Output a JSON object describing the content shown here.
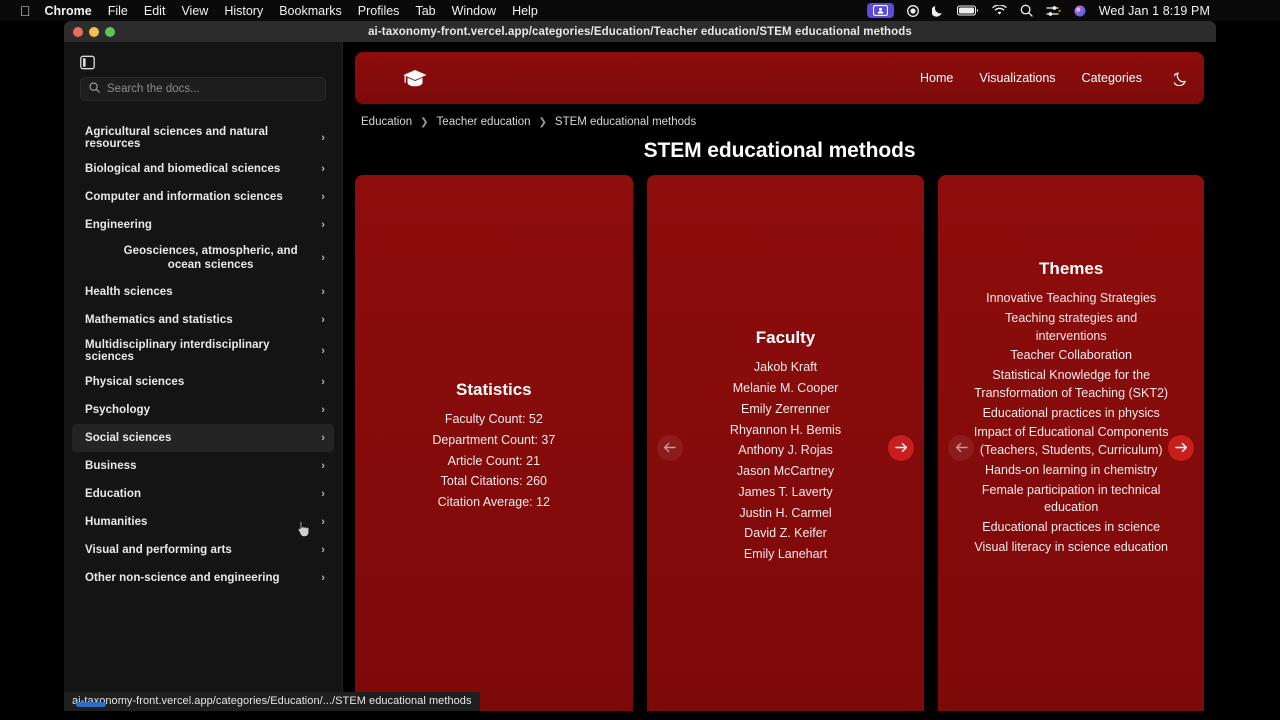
{
  "menubar": {
    "apple_icon": "apple-icon",
    "items": [
      {
        "label": "Chrome",
        "bold": true
      },
      {
        "label": "File",
        "bold": false
      },
      {
        "label": "Edit",
        "bold": false
      },
      {
        "label": "View",
        "bold": false
      },
      {
        "label": "History",
        "bold": false
      },
      {
        "label": "Bookmarks",
        "bold": false
      },
      {
        "label": "Profiles",
        "bold": false
      },
      {
        "label": "Tab",
        "bold": false
      },
      {
        "label": "Window",
        "bold": false
      },
      {
        "label": "Help",
        "bold": false
      }
    ],
    "status_icons": [
      "screen-share-icon",
      "record-icon",
      "moon-icon",
      "battery-icon",
      "wifi-icon",
      "search-icon",
      "control-center-icon",
      "siri-icon"
    ],
    "datetime": "Wed Jan 1  8:19 PM",
    "highlight_color": "#5b4bd6"
  },
  "window": {
    "title_url": "ai-taxonomy-front.vercel.app/categories/Education/Teacher education/STEM educational methods",
    "traffic_lights": [
      "close-button",
      "minimize-button",
      "maximize-button"
    ]
  },
  "sidebar": {
    "toggle_icon": "sidebar-toggle-icon",
    "search": {
      "icon": "search-icon",
      "placeholder": "Search the docs...",
      "value": ""
    },
    "items": [
      {
        "label": "Agricultural sciences and natural resources",
        "sub": false,
        "active": false
      },
      {
        "label": "Biological and biomedical sciences",
        "sub": false,
        "active": false
      },
      {
        "label": "Computer and information sciences",
        "sub": false,
        "active": false
      },
      {
        "label": "Engineering",
        "sub": false,
        "active": false
      },
      {
        "label": "Geosciences, atmospheric, and ocean sciences",
        "sub": true,
        "active": false
      },
      {
        "label": "Health sciences",
        "sub": false,
        "active": false
      },
      {
        "label": "Mathematics and statistics",
        "sub": false,
        "active": false
      },
      {
        "label": "Multidisciplinary interdisciplinary sciences",
        "sub": false,
        "active": false
      },
      {
        "label": "Physical sciences",
        "sub": false,
        "active": false
      },
      {
        "label": "Psychology",
        "sub": false,
        "active": false
      },
      {
        "label": "Social sciences",
        "sub": false,
        "active": true
      },
      {
        "label": "Business",
        "sub": false,
        "active": false
      },
      {
        "label": "Education",
        "sub": false,
        "active": false
      },
      {
        "label": "Humanities",
        "sub": false,
        "active": false
      },
      {
        "label": "Visual and performing arts",
        "sub": false,
        "active": false
      },
      {
        "label": "Other non-science and engineering",
        "sub": false,
        "active": false
      }
    ],
    "chevron_icon": "chevron-right-icon"
  },
  "site_header": {
    "logo_icon": "graduation-cap-icon",
    "nav": [
      {
        "label": "Home"
      },
      {
        "label": "Visualizations"
      },
      {
        "label": "Categories"
      }
    ],
    "theme_toggle_icon": "moon-icon",
    "brand_color": "#8d0d0d"
  },
  "breadcrumb": [
    {
      "label": "Education"
    },
    {
      "label": "Teacher education"
    },
    {
      "label": "STEM educational methods"
    }
  ],
  "page_title": "STEM educational methods",
  "cards": [
    {
      "id": "statistics-card",
      "heading": "Statistics",
      "items": [
        "Faculty Count: 52",
        "Department Count: 37",
        "Article Count: 21",
        "Total Citations: 260",
        "Citation Average: 12"
      ],
      "prev_arrow": false,
      "next_arrow": false
    },
    {
      "id": "faculty-card",
      "heading": "Faculty",
      "items": [
        "Jakob Kraft",
        "Melanie M. Cooper",
        "Emily Zerrenner",
        "Rhyannon H. Bemis",
        "Anthony J. Rojas",
        "Jason McCartney",
        "James T. Laverty",
        "Justin H. Carmel",
        "David Z. Keifer",
        "Emily Lanehart"
      ],
      "prev_arrow": true,
      "next_arrow": true
    },
    {
      "id": "themes-card",
      "heading": "Themes",
      "items": [
        "Innovative Teaching Strategies",
        "Teaching strategies and interventions",
        "Teacher Collaboration",
        "Statistical Knowledge for the Transformation of Teaching (SKT2)",
        "Educational practices in physics",
        "Impact of Educational Components (Teachers, Students, Curriculum)",
        "Hands-on learning in chemistry",
        "Female participation in technical education",
        "Educational practices in science",
        "Visual literacy in science education"
      ],
      "prev_arrow": true,
      "next_arrow": true
    }
  ],
  "statusbar": {
    "link_url": "ai-taxonomy-front.vercel.app/categories/Education/.../STEM educational methods"
  }
}
